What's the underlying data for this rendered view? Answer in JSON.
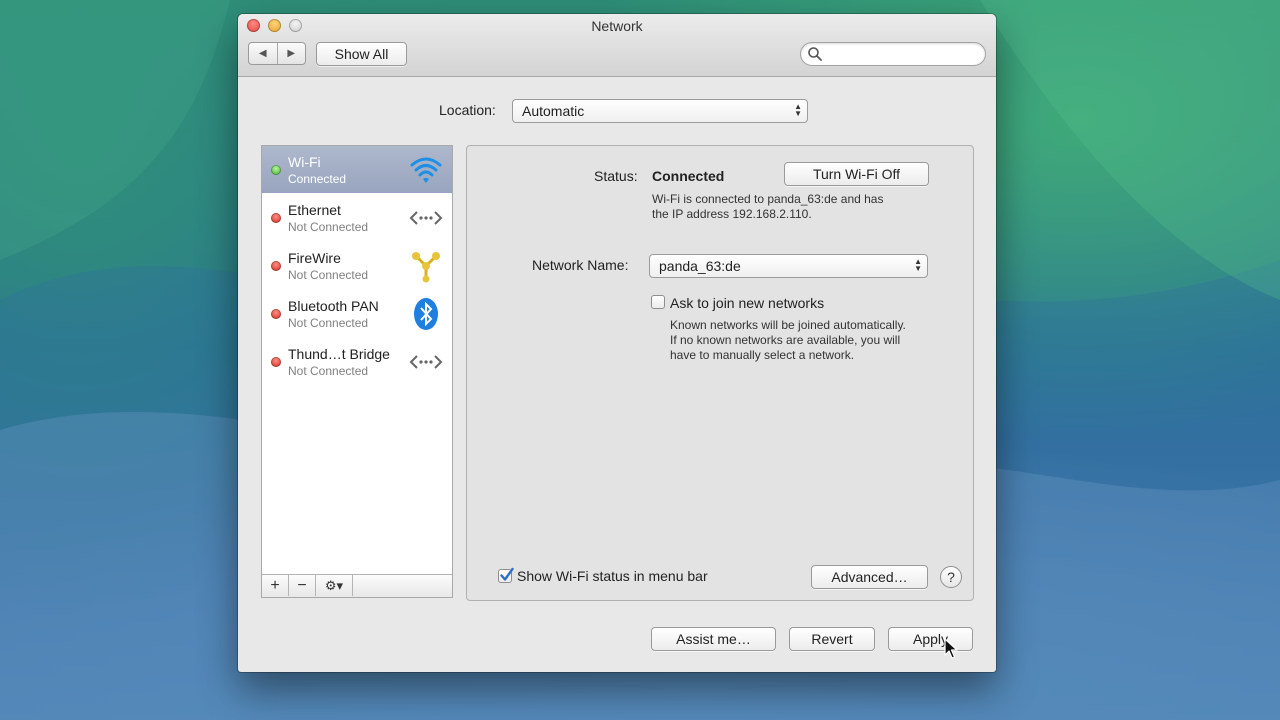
{
  "window": {
    "title": "Network",
    "show_all_label": "Show All",
    "back_glyph": "◀",
    "forward_glyph": "▶",
    "search": {
      "placeholder": "",
      "value": ""
    }
  },
  "location": {
    "label": "Location:",
    "value": "Automatic"
  },
  "services": [
    {
      "name": "Wi-Fi",
      "status": "Connected",
      "state_color": "#3ea82a",
      "icon": "wifi-icon",
      "selected": true
    },
    {
      "name": "Ethernet",
      "status": "Not Connected",
      "state_color": "#cf2418",
      "icon": "ethernet-icon",
      "selected": false
    },
    {
      "name": "FireWire",
      "status": "Not Connected",
      "state_color": "#cf2418",
      "icon": "firewire-icon",
      "selected": false
    },
    {
      "name": "Bluetooth PAN",
      "status": "Not Connected",
      "state_color": "#cf2418",
      "icon": "bluetooth-icon",
      "selected": false
    },
    {
      "name": "Thund…t Bridge",
      "status": "Not Connected",
      "state_color": "#cf2418",
      "icon": "thunderbolt-bridge-icon",
      "selected": false
    }
  ],
  "sidebar_bar": {
    "add_glyph": "+",
    "remove_glyph": "−",
    "action_glyph": "⚙▾"
  },
  "detail": {
    "status_label": "Status:",
    "status_value": "Connected",
    "toggle_button": "Turn Wi-Fi Off",
    "status_desc_line1": "Wi-Fi is connected to panda_63:de and has",
    "status_desc_line2": "the IP address 192.168.2.110.",
    "network_name_label": "Network Name:",
    "network_name_value": "panda_63:de",
    "ask_join_label": "Ask to join new networks",
    "ask_join_checked": false,
    "ask_desc_line1": "Known networks will be joined automatically.",
    "ask_desc_line2": "If no known networks are available, you will",
    "ask_desc_line3": "have to manually select a network.",
    "show_status_label": "Show Wi-Fi status in menu bar",
    "show_status_checked": true,
    "advanced_button": "Advanced…",
    "help_glyph": "?"
  },
  "footer": {
    "assist_button": "Assist me…",
    "revert_button": "Revert",
    "apply_button": "Apply"
  },
  "colors": {
    "selection": "#98a5bf",
    "checkbox_accent": "#2f6fc9"
  }
}
